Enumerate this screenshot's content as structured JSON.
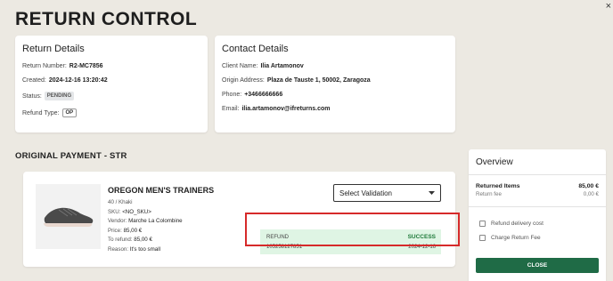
{
  "page": {
    "title": "RETURN CONTROL",
    "close": "×"
  },
  "return_details": {
    "title": "Return Details",
    "number_label": "Return Number:",
    "number": "R2-MC7856",
    "created_label": "Created:",
    "created": "2024-12-16 13:20:42",
    "status_label": "Status:",
    "status": "PENDING",
    "refund_type_label": "Refund Type:",
    "refund_type": "OP"
  },
  "contact_details": {
    "title": "Contact Details",
    "client_label": "Client Name:",
    "client": "Ilia Artamonov",
    "address_label": "Origin Address:",
    "address": "Plaza de Tauste 1, 50002, Zaragoza",
    "phone_label": "Phone:",
    "phone": "+3466666666",
    "email_label": "Email:",
    "email": "ilia.artamonov@ifreturns.com"
  },
  "payment": {
    "section_title": "ORIGINAL PAYMENT - STR",
    "product": {
      "name": "OREGON MEN'S TRAINERS",
      "variant": "40 / Khaki",
      "sku_label": "SKU:",
      "sku": "<NO_SKU>",
      "vendor_label": "Vendor:",
      "vendor": "Marche La Colombine",
      "price_label": "Price:",
      "price": "85,00 €",
      "to_refund_label": "To refund:",
      "to_refund": "85,00 €",
      "reason_label": "Reason:",
      "reason": "It's too small"
    },
    "select_validation": "Select Validation",
    "refund": {
      "label": "REFUND",
      "status": "SUCCESS",
      "id": "105258127851",
      "date": "2024-12-16"
    }
  },
  "overview": {
    "title": "Overview",
    "returned_items_label": "Returned Items",
    "returned_items_value": "85,00 €",
    "return_fee_label": "Return fee",
    "return_fee_value": "0,00 €",
    "refund_delivery_cost": "Refund delivery cost",
    "charge_return_fee": "Charge Return Fee",
    "close_button": "CLOSE"
  },
  "colors": {
    "accent": "#1f6b46",
    "success_bg": "#dff5e4",
    "success_text": "#1f7a3a",
    "highlight": "#d62a2a"
  }
}
